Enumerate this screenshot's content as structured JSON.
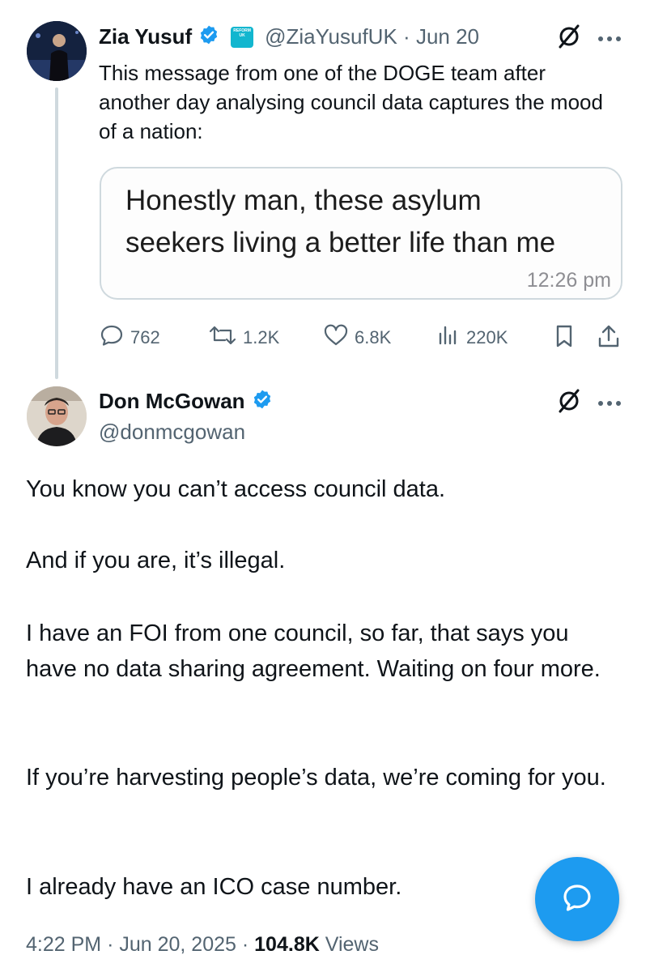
{
  "reply_to": {
    "name": "Zia Yusuf",
    "affiliate_badge": "REFORM UK",
    "handle": "@ZiaYusufUK",
    "sep": "·",
    "date": "Jun 20",
    "text": "This message from one of the DOGE team after another day analysing council data captures the mood of a nation:",
    "quote": {
      "line1": "Honestly man, these asylum",
      "line2": "seekers living a better life than me",
      "time": "12:26 pm"
    },
    "actions": {
      "replies": "762",
      "reposts": "1.2K",
      "likes": "6.8K",
      "views": "220K"
    }
  },
  "main": {
    "name": "Don McGowan",
    "handle": "@donmcgowan",
    "paragraphs": [
      "You know you can’t access council data.",
      "And if you are, it’s illegal.",
      "I have an FOI from one council, so far, that says you have no data sharing agreement. Waiting on four more.",
      "If you’re harvesting people’s data, we’re coming for you.",
      "I already have an ICO case number."
    ],
    "footer": {
      "time": "4:22 PM",
      "sep1": "·",
      "date": "Jun 20, 2025",
      "sep2": "·",
      "views_count": "104.8K",
      "views_label": "Views"
    }
  },
  "colors": {
    "verified": "#1d9bf0",
    "muted": "#536471",
    "accent": "#1d9bf0"
  }
}
